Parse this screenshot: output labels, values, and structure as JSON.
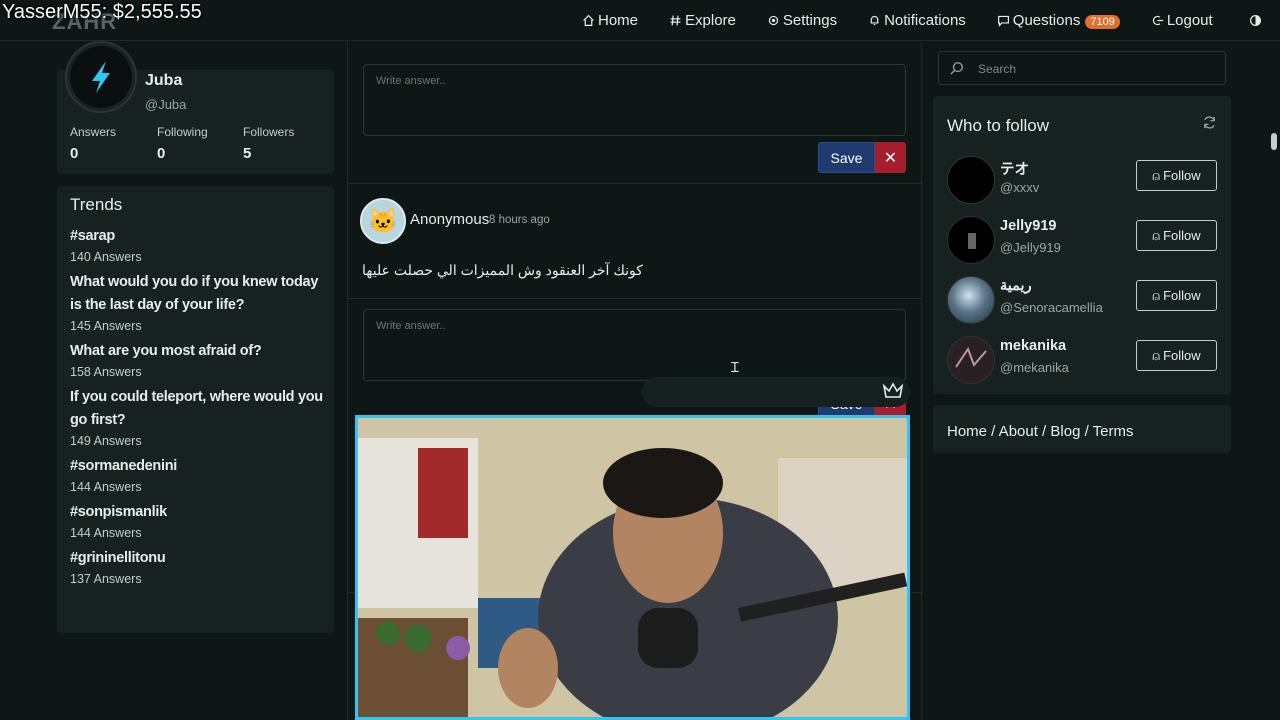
{
  "overlay": {
    "donation_text": "YasserM55: $2,555.55"
  },
  "brand": {
    "logo_text": "ZAHR"
  },
  "nav": [
    {
      "label": "Home",
      "icon": "home-icon"
    },
    {
      "label": "Explore",
      "icon": "hash-icon"
    },
    {
      "label": "Settings",
      "icon": "gear-icon"
    },
    {
      "label": "Notifications",
      "icon": "bell-icon"
    },
    {
      "label": "Questions",
      "icon": "chat-icon",
      "badge": "7109"
    },
    {
      "label": "Logout",
      "icon": "logout-icon"
    }
  ],
  "profile": {
    "name": "Juba",
    "handle": "@Juba",
    "stats": [
      {
        "label": "Answers",
        "value": "0"
      },
      {
        "label": "Following",
        "value": "0"
      },
      {
        "label": "Followers",
        "value": "5"
      }
    ]
  },
  "trends": {
    "title": "Trends",
    "items": [
      {
        "name": "#sarap",
        "count": "140 Answers"
      },
      {
        "name": "What would you do if you knew today is the last day of your life?",
        "count": "145 Answers"
      },
      {
        "name": "What are you most afraid of?",
        "count": "158 Answers"
      },
      {
        "name": "If you could teleport, where would you go first?",
        "count": "149 Answers"
      },
      {
        "name": "#sormanedenini",
        "count": "144 Answers"
      },
      {
        "name": "#sonpismanlik",
        "count": "144 Answers"
      },
      {
        "name": "#grininellitonu",
        "count": "137 Answers"
      }
    ]
  },
  "feed": {
    "answer_placeholder": "Write answer..",
    "save_label": "Save",
    "cancel_label": "✕",
    "question": {
      "author": "Anonymous",
      "time": "8 hours ago",
      "text": "كونك آخر العنقود وش المميزات الي حصلت عليها"
    }
  },
  "sidebar": {
    "search_placeholder": "Search",
    "who_to_follow_title": "Who to follow",
    "follow_label": "Follow",
    "users": [
      {
        "name": "テオ",
        "handle": "@xxxv"
      },
      {
        "name": "Jelly919",
        "handle": "@Jelly919"
      },
      {
        "name": "ريمية",
        "handle": "@Senoracamellia"
      },
      {
        "name": "mekanika",
        "handle": "@mekanika"
      }
    ],
    "footer_links": "Home / About / Blog / Terms"
  },
  "colors": {
    "background": "#0f1716",
    "card": "#172120",
    "save_button": "#1e3a6e",
    "cancel_button": "#a61d2c",
    "badge": "#e0712b",
    "cam_border": "#33c4f0"
  }
}
